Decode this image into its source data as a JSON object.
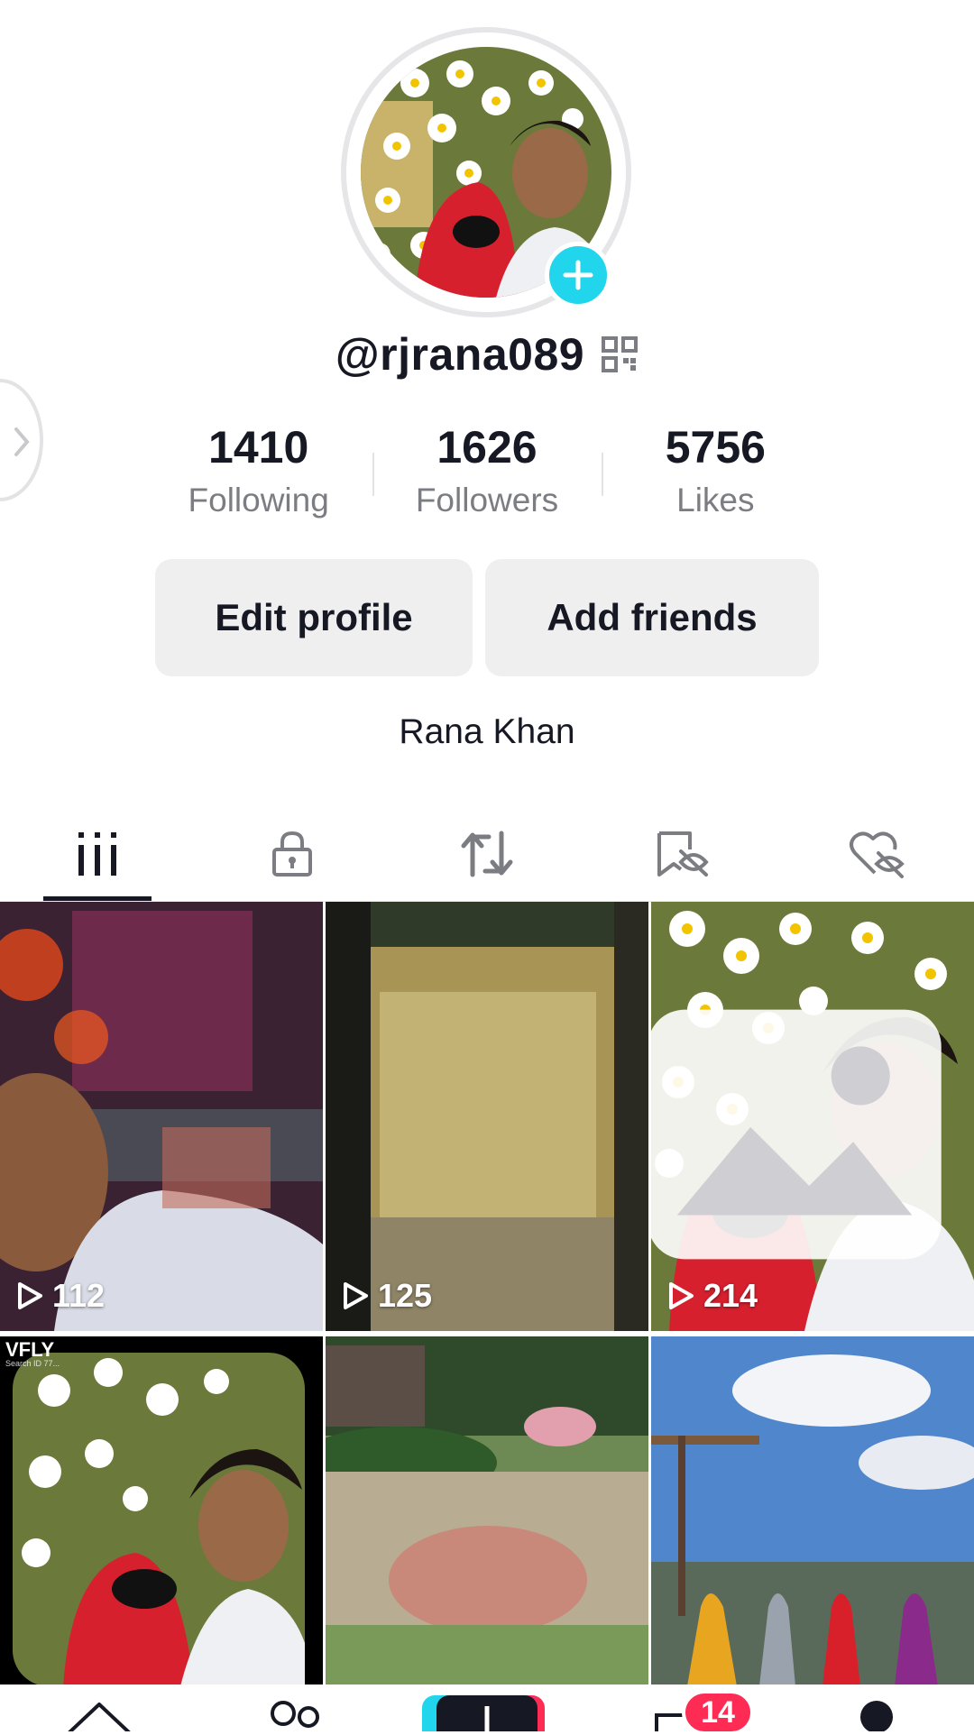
{
  "profile": {
    "username": "@rjrana089",
    "display_name": "Rana Khan",
    "stats": [
      {
        "value": "1410",
        "label": "Following"
      },
      {
        "value": "1626",
        "label": "Followers"
      },
      {
        "value": "5756",
        "label": "Likes"
      }
    ],
    "edit_profile_label": "Edit profile",
    "add_friends_label": "Add friends"
  },
  "tabs": [
    {
      "icon": "grid-icon",
      "active": true
    },
    {
      "icon": "lock-icon"
    },
    {
      "icon": "repost-icon"
    },
    {
      "icon": "bookmark-hidden-icon"
    },
    {
      "icon": "heart-hidden-icon"
    }
  ],
  "videos": [
    {
      "views": "112"
    },
    {
      "views": "125"
    },
    {
      "views": "214"
    },
    {
      "views": "",
      "watermark": "VFLY",
      "watermark_sub": "Search ID 77..."
    },
    {
      "views": ""
    },
    {
      "views": ""
    }
  ],
  "nav": {
    "inbox_badge": "14"
  },
  "colors": {
    "accent": "#20d5ec",
    "badge": "#fe2c55",
    "text": "#161823",
    "muted": "#7c7d82"
  }
}
